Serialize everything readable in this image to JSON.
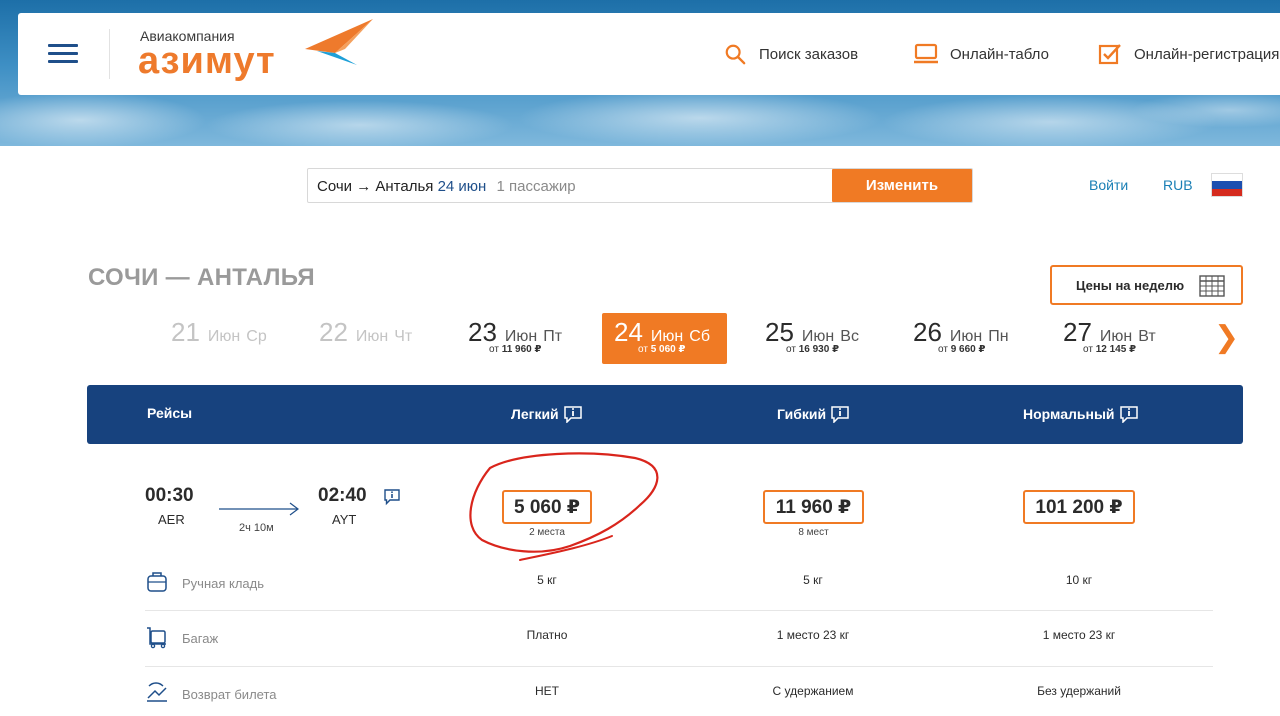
{
  "colors": {
    "accent": "#f07a24",
    "navy": "#17427e",
    "link": "#1a7fb5"
  },
  "header": {
    "menu_icon": "hamburger-menu-icon",
    "brand_sub": "Авиакомпания",
    "brand_name": "азимут",
    "links": [
      {
        "icon": "search-icon",
        "label": "Поиск заказов"
      },
      {
        "icon": "monitor-icon",
        "label": "Онлайн-табло"
      },
      {
        "icon": "checkbox-icon",
        "label": "Онлайн-регистрация"
      }
    ]
  },
  "search": {
    "route": "Сочи → Анталья",
    "date": "24 июн",
    "passengers": "1 пассажир",
    "change_label": "Изменить"
  },
  "account": {
    "login": "Войти",
    "currency": "RUB",
    "flag_icon": "russia-flag-icon"
  },
  "route_title": "СОЧИ — АНТАЛЬЯ",
  "week_prices_label": "Цены на неделю",
  "dates": [
    {
      "day": "21",
      "month": "Июн",
      "weekday": "Ср",
      "price_prefix": "",
      "price": "",
      "state": "disabled"
    },
    {
      "day": "22",
      "month": "Июн",
      "weekday": "Чт",
      "price_prefix": "",
      "price": "",
      "state": "disabled"
    },
    {
      "day": "23",
      "month": "Июн",
      "weekday": "Пт",
      "price_prefix": "от",
      "price": "11 960 ₽",
      "state": "normal"
    },
    {
      "day": "24",
      "month": "Июн",
      "weekday": "Сб",
      "price_prefix": "от",
      "price": "5 060 ₽",
      "state": "active"
    },
    {
      "day": "25",
      "month": "Июн",
      "weekday": "Вс",
      "price_prefix": "от",
      "price": "16 930 ₽",
      "state": "normal"
    },
    {
      "day": "26",
      "month": "Июн",
      "weekday": "Пн",
      "price_prefix": "от",
      "price": "9 660 ₽",
      "state": "normal"
    },
    {
      "day": "27",
      "month": "Июн",
      "weekday": "Вт",
      "price_prefix": "от",
      "price": "12 145 ₽",
      "state": "normal"
    }
  ],
  "next_arrow": "❯",
  "fares_header": {
    "flights": "Рейсы",
    "fares": [
      "Легкий",
      "Гибкий",
      "Нормальный"
    ]
  },
  "flight": {
    "dep_time": "00:30",
    "dep_code": "AER",
    "arr_time": "02:40",
    "arr_code": "AYT",
    "duration": "2ч 10м",
    "prices": [
      {
        "price": "5 060 ₽",
        "seats": "2 места"
      },
      {
        "price": "11 960 ₽",
        "seats": "8 мест"
      },
      {
        "price": "101 200 ₽",
        "seats": ""
      }
    ]
  },
  "features": [
    {
      "icon": "carry-on-bag-icon",
      "label": "Ручная кладь",
      "values": [
        "5 кг",
        "5 кг",
        "10 кг"
      ]
    },
    {
      "icon": "luggage-cart-icon",
      "label": "Багаж",
      "values": [
        "Платно",
        "1 место 23 кг",
        "1 место 23 кг"
      ]
    },
    {
      "icon": "ticket-refund-icon",
      "label": "Возврат билета",
      "values": [
        "НЕТ",
        "С удержанием",
        "Без удержаний"
      ]
    }
  ]
}
